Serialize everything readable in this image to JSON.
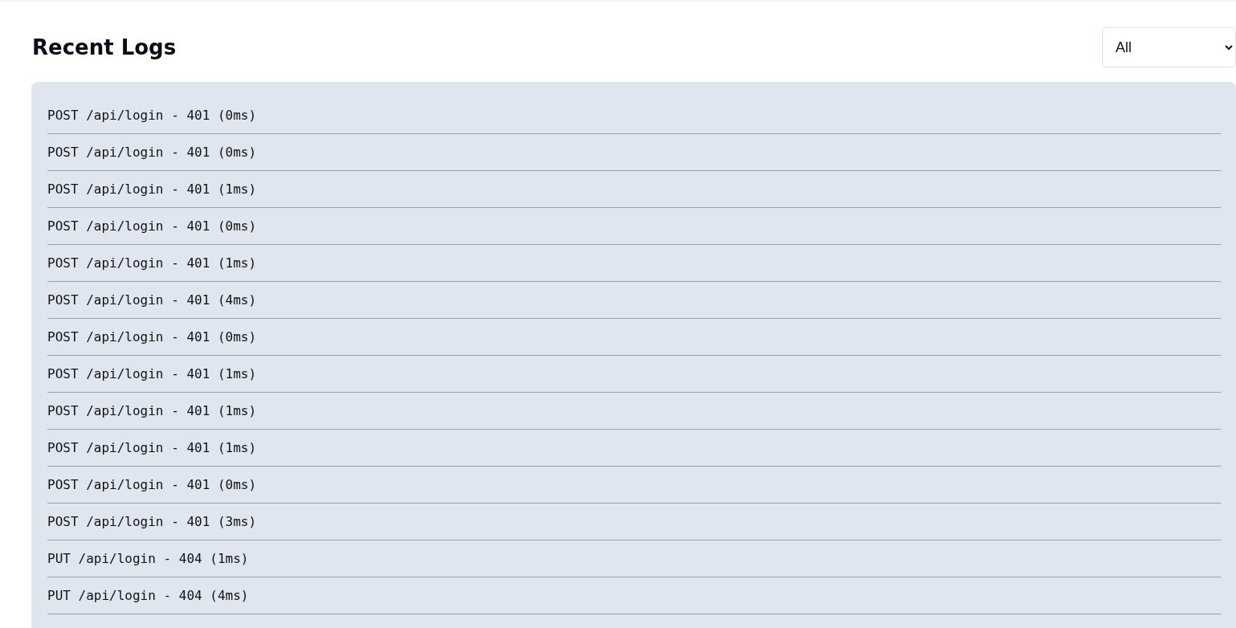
{
  "title": "Recent Logs",
  "filter": {
    "value": "All"
  },
  "logs": [
    "POST /api/login - 401 (0ms)",
    "POST /api/login - 401 (0ms)",
    "POST /api/login - 401 (1ms)",
    "POST /api/login - 401 (0ms)",
    "POST /api/login - 401 (1ms)",
    "POST /api/login - 401 (4ms)",
    "POST /api/login - 401 (0ms)",
    "POST /api/login - 401 (1ms)",
    "POST /api/login - 401 (1ms)",
    "POST /api/login - 401 (1ms)",
    "POST /api/login - 401 (0ms)",
    "POST /api/login - 401 (3ms)",
    "PUT /api/login - 404 (1ms)",
    "PUT /api/login - 404 (4ms)"
  ]
}
